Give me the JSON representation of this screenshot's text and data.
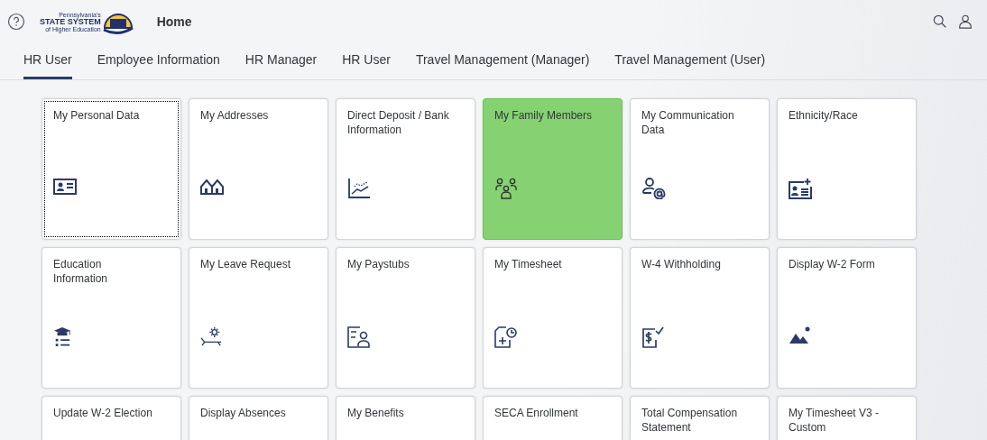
{
  "header": {
    "logo_lines": [
      "Pennsylvania's",
      "STATE SYSTEM",
      "of Higher Education"
    ],
    "title": "Home"
  },
  "tabs": [
    {
      "label": "HR User",
      "selected": true
    },
    {
      "label": "Employee Information",
      "selected": false
    },
    {
      "label": "HR Manager",
      "selected": false
    },
    {
      "label": "HR User",
      "selected": false
    },
    {
      "label": "Travel Management (Manager)",
      "selected": false
    },
    {
      "label": "Travel Management (User)",
      "selected": false
    }
  ],
  "tiles": [
    {
      "title": "My Personal Data",
      "kind": "id-card",
      "selected": false,
      "focused": true
    },
    {
      "title": "My Addresses",
      "kind": "houses",
      "selected": false,
      "focused": false
    },
    {
      "title": "Direct Deposit / Bank Information",
      "kind": "chart",
      "selected": false,
      "focused": false
    },
    {
      "title": "My Family Members",
      "kind": "family",
      "selected": true,
      "focused": false
    },
    {
      "title": "My Communication Data",
      "kind": "person-at",
      "selected": false,
      "focused": false
    },
    {
      "title": "Ethnicity/Race",
      "kind": "card-add",
      "selected": false,
      "focused": false
    },
    {
      "title": "Education Information",
      "kind": "education",
      "selected": false,
      "focused": false
    },
    {
      "title": "My Leave Request",
      "kind": "leave",
      "selected": false,
      "focused": false
    },
    {
      "title": "My Paystubs",
      "kind": "paystub",
      "selected": false,
      "focused": false
    },
    {
      "title": "My Timesheet",
      "kind": "timesheet",
      "selected": false,
      "focused": false
    },
    {
      "title": "W-4 Withholding",
      "kind": "money-check",
      "selected": false,
      "focused": false
    },
    {
      "title": "Display W-2 Form",
      "kind": "landscape",
      "selected": false,
      "focused": false
    },
    {
      "title": "Update W-2 Election",
      "kind": "none",
      "selected": false,
      "focused": false
    },
    {
      "title": "Display Absences",
      "kind": "none",
      "selected": false,
      "focused": false
    },
    {
      "title": "My Benefits",
      "kind": "none",
      "selected": false,
      "focused": false
    },
    {
      "title": "SECA Enrollment",
      "kind": "none",
      "selected": false,
      "focused": false
    },
    {
      "title": "Total Compensation Statement",
      "kind": "none",
      "selected": false,
      "focused": false
    },
    {
      "title": "My Timesheet V3 - Custom",
      "kind": "none",
      "selected": false,
      "focused": false
    }
  ]
}
